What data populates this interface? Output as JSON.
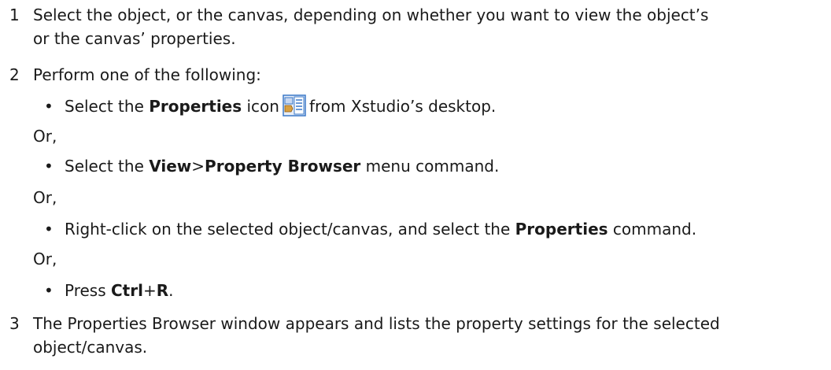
{
  "steps": [
    {
      "num": "1",
      "line1": "Select the object, or the canvas, depending on whether you want to view the object’s",
      "line2": "or the canvas’ properties."
    },
    {
      "num": "2",
      "text": "Perform one of the following:"
    },
    {
      "num": "3",
      "line1": "The Properties Browser window appears and lists the property settings for the selected",
      "line2": "object/canvas."
    }
  ],
  "or_label": "Or,",
  "bullets": {
    "b1": {
      "pre": "Select the ",
      "bold": "Properties",
      "mid": " icon",
      "post": "from Xstudio’s desktop.",
      "icon": "properties-icon"
    },
    "b2": {
      "pre": "Select the ",
      "bold1": "View",
      "sep": ">",
      "bold2": "Property Browser",
      "post": " menu command."
    },
    "b3": {
      "pre": "Right-click on the selected object/canvas, and select the ",
      "bold": "Properties",
      "post": " command."
    },
    "b4": {
      "pre": "Press ",
      "bold1": "Ctrl",
      "sep": "+",
      "bold2": "R",
      "post": "."
    }
  },
  "bullet_char": "•",
  "colors": {
    "text": "#1a1a1a",
    "icon_blue": "#3a78c8"
  }
}
